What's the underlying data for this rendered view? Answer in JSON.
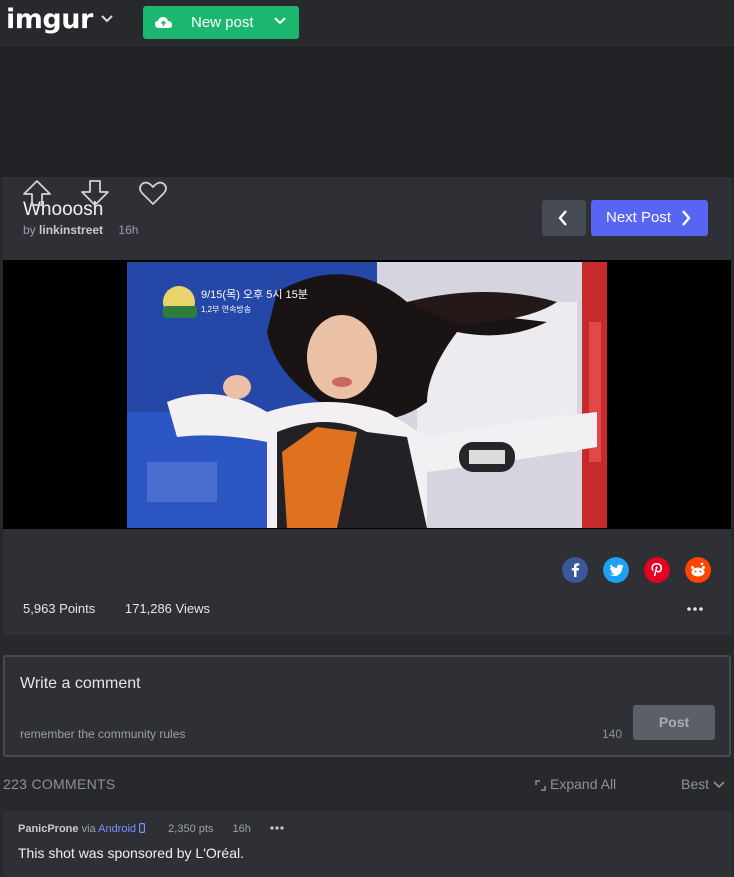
{
  "header": {
    "logo": "imgur",
    "new_post_label": "New post"
  },
  "post": {
    "title": "Whooosh",
    "by_prefix": "by",
    "author": "linkinstreet",
    "age": "16h",
    "next_label": "Next Post",
    "image_overlay_text": "9/15(목) 오후 5시 15분",
    "image_overlay_sub": "1,2부 연속방송",
    "points": "5,963 Points",
    "views": "171,286 Views"
  },
  "share_icons": [
    {
      "name": "facebook",
      "color": "#3b5998"
    },
    {
      "name": "twitter",
      "color": "#1da1f2"
    },
    {
      "name": "pinterest",
      "color": "#e60023"
    },
    {
      "name": "reddit",
      "color": "#ff4500"
    }
  ],
  "comment_form": {
    "placeholder": "Write a comment",
    "rules_text": "remember the community rules",
    "char_count": "140",
    "post_label": "Post"
  },
  "comments_section": {
    "count_label": "223 COMMENTS",
    "expand_label": "Expand All",
    "sort_label": "Best"
  },
  "comments": [
    {
      "user": "PanicProne",
      "via": "via",
      "platform": "Android",
      "points": "2,350 pts",
      "age": "16h",
      "text": "This shot was sponsored by L'Oréal."
    }
  ],
  "colors": {
    "new_post_green": "#1bb76e",
    "next_post_blue": "#5865f2",
    "background": "#27292d"
  }
}
